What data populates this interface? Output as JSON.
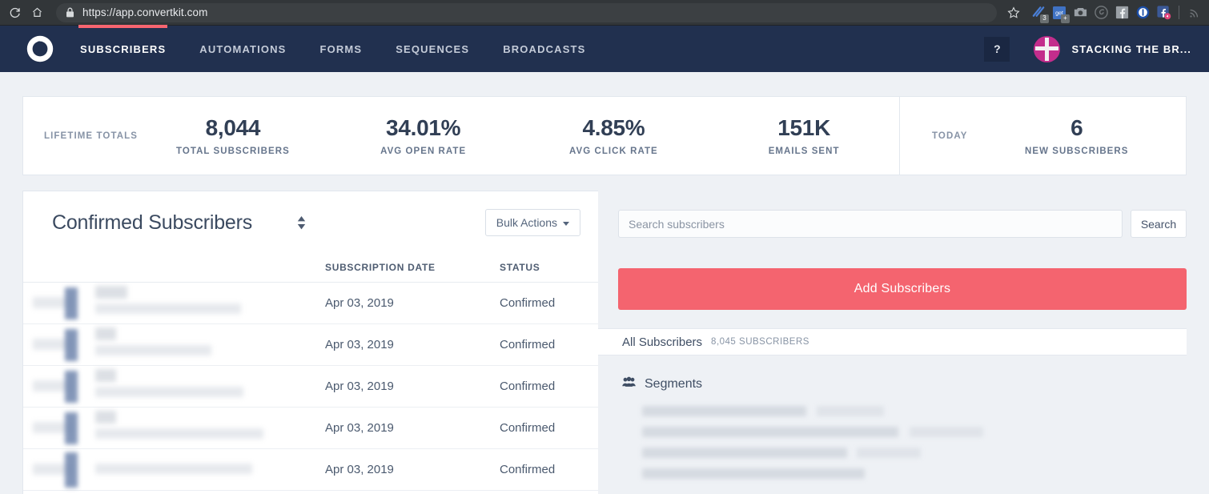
{
  "browser": {
    "url": "https://app.convertkit.com",
    "reload_icon": "reload-icon",
    "home_icon": "home-icon",
    "lock_icon": "lock-icon",
    "bookmark_icon": "star-icon",
    "extensions": [
      {
        "name": "grammarly-extension-icon",
        "badge": "3"
      },
      {
        "name": "pocket-extension-icon",
        "badge": "+"
      },
      {
        "name": "screenshot-extension-icon",
        "badge": ""
      },
      {
        "name": "evernote-extension-icon",
        "badge": ""
      },
      {
        "name": "facebook-extension-icon",
        "badge": ""
      },
      {
        "name": "onepassword-extension-icon",
        "badge": ""
      },
      {
        "name": "facebook-pixel-extension-icon",
        "badge": ""
      },
      {
        "name": "rss-feed-extension-icon",
        "badge": ""
      }
    ]
  },
  "nav": {
    "logo": "convertkit-logo",
    "links": [
      {
        "label": "SUBSCRIBERS",
        "active": true
      },
      {
        "label": "AUTOMATIONS",
        "active": false
      },
      {
        "label": "FORMS",
        "active": false
      },
      {
        "label": "SEQUENCES",
        "active": false
      },
      {
        "label": "BROADCASTS",
        "active": false
      }
    ],
    "help_label": "?",
    "account_name": "STACKING THE BR...",
    "avatar": "account-avatar"
  },
  "stats": {
    "lifetime_label": "LIFETIME TOTALS",
    "lifetime": [
      {
        "value": "8,044",
        "label": "TOTAL SUBSCRIBERS"
      },
      {
        "value": "34.01%",
        "label": "AVG OPEN RATE"
      },
      {
        "value": "4.85%",
        "label": "AVG CLICK RATE"
      },
      {
        "value": "151K",
        "label": "EMAILS SENT"
      }
    ],
    "today_label": "TODAY",
    "today": [
      {
        "value": "6",
        "label": "NEW SUBSCRIBERS"
      }
    ]
  },
  "subscribers_panel": {
    "title": "Confirmed Subscribers",
    "sort_icon": "sort-updown-icon",
    "bulk_actions_label": "Bulk Actions",
    "columns": [
      "",
      "SUBSCRIPTION DATE",
      "STATUS"
    ],
    "rows": [
      {
        "person": "",
        "date": "Apr 03, 2019",
        "status": "Confirmed"
      },
      {
        "person": "",
        "date": "Apr 03, 2019",
        "status": "Confirmed"
      },
      {
        "person": "",
        "date": "Apr 03, 2019",
        "status": "Confirmed"
      },
      {
        "person": "",
        "date": "Apr 03, 2019",
        "status": "Confirmed"
      },
      {
        "person": "",
        "date": "Apr 03, 2019",
        "status": "Confirmed"
      }
    ]
  },
  "sidebar": {
    "search_placeholder": "Search subscribers",
    "search_value": "",
    "search_button": "Search",
    "add_subscribers_label": "Add Subscribers",
    "all_subscribers_label": "All Subscribers",
    "all_subscribers_count": "8,045 SUBSCRIBERS",
    "segments_icon": "people-group-icon",
    "segments_label": "Segments",
    "segments": [
      "",
      "",
      "",
      ""
    ]
  },
  "colors": {
    "nav_background": "#21304f",
    "accent": "#f86570",
    "add_button": "#f4646f",
    "page_background": "#eef1f5",
    "avatar": "#c32d8c",
    "browser_chrome": "#323639"
  }
}
